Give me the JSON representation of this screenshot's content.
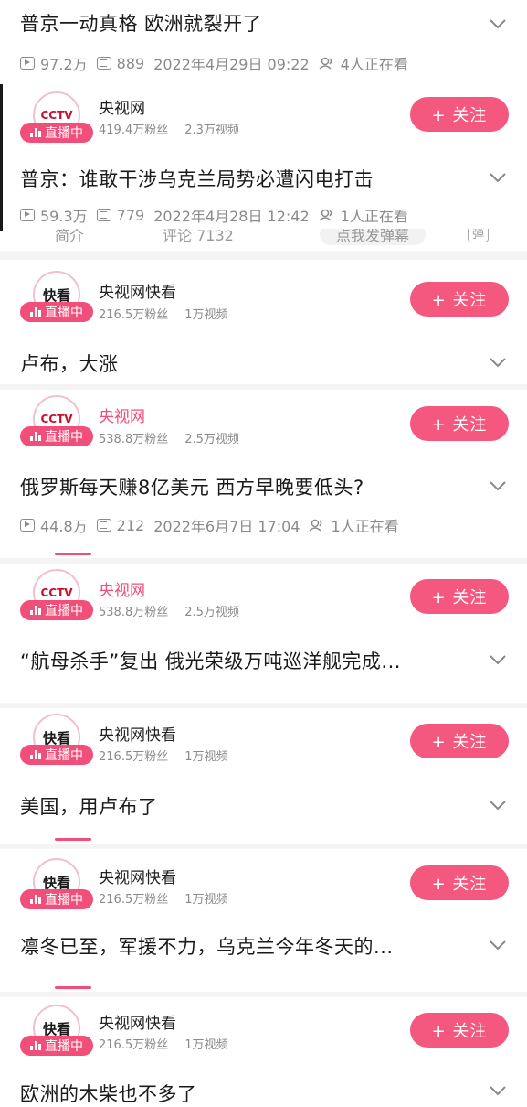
{
  "items": [
    {
      "title": "普京一动真格 欧洲就裂开了",
      "views": "97.2万",
      "comments": "889",
      "date": "2022年4月29日 09:22",
      "watching": "4人正在看"
    },
    {
      "channel": "央视网",
      "fans": "419.4万粉丝",
      "videos": "2.3万视频",
      "title": "普京：谁敢干涉乌克兰局势必遭闪电打击",
      "views": "59.3万",
      "comments": "779",
      "date": "2022年4月28日 12:42",
      "watching": "1人正在看"
    },
    {
      "channel": "央视网快看",
      "fans": "216.5万粉丝",
      "videos": "1万视频",
      "title": "卢布，大涨"
    },
    {
      "channel": "央视网",
      "fans": "538.8万粉丝",
      "videos": "2.5万视频",
      "title": "俄罗斯每天赚8亿美元 西方早晚要低头?",
      "views": "44.8万",
      "comments": "212",
      "date": "2022年6月7日 17:04",
      "watching": "1人正在看"
    },
    {
      "channel": "央视网",
      "fans": "538.8万粉丝",
      "videos": "2.5万视频",
      "title": "“航母杀手”复出 俄光荣级万吨巡洋舰完成..."
    },
    {
      "channel": "央视网快看",
      "fans": "216.5万粉丝",
      "videos": "1万视频",
      "title": "美国，用卢布了"
    },
    {
      "channel": "央视网快看",
      "fans": "216.5万粉丝",
      "videos": "1万视频",
      "title": "凛冬已至，军援不力，乌克兰今年冬天的..."
    },
    {
      "channel": "央视网快看",
      "fans": "216.5万粉丝",
      "videos": "1万视频",
      "title": "欧洲的木柴也不多了"
    }
  ],
  "live_label": "直播中",
  "follow_label": "+ 关注",
  "logo_cctv": "CCTV",
  "logo_kuaikan": "快看",
  "tabs": {
    "intro": "简介",
    "comments": "评论 7132",
    "danmaku": "点我发弹幕",
    "danmu_btn": "弹"
  },
  "colors": {
    "accent": "#f4587f",
    "muted": "#8a8a8a"
  },
  "icons": {
    "views": "play-icon",
    "comments": "list-icon",
    "watching": "people-icon",
    "expand": "chevron-down-icon",
    "live": "live-bars-icon"
  }
}
